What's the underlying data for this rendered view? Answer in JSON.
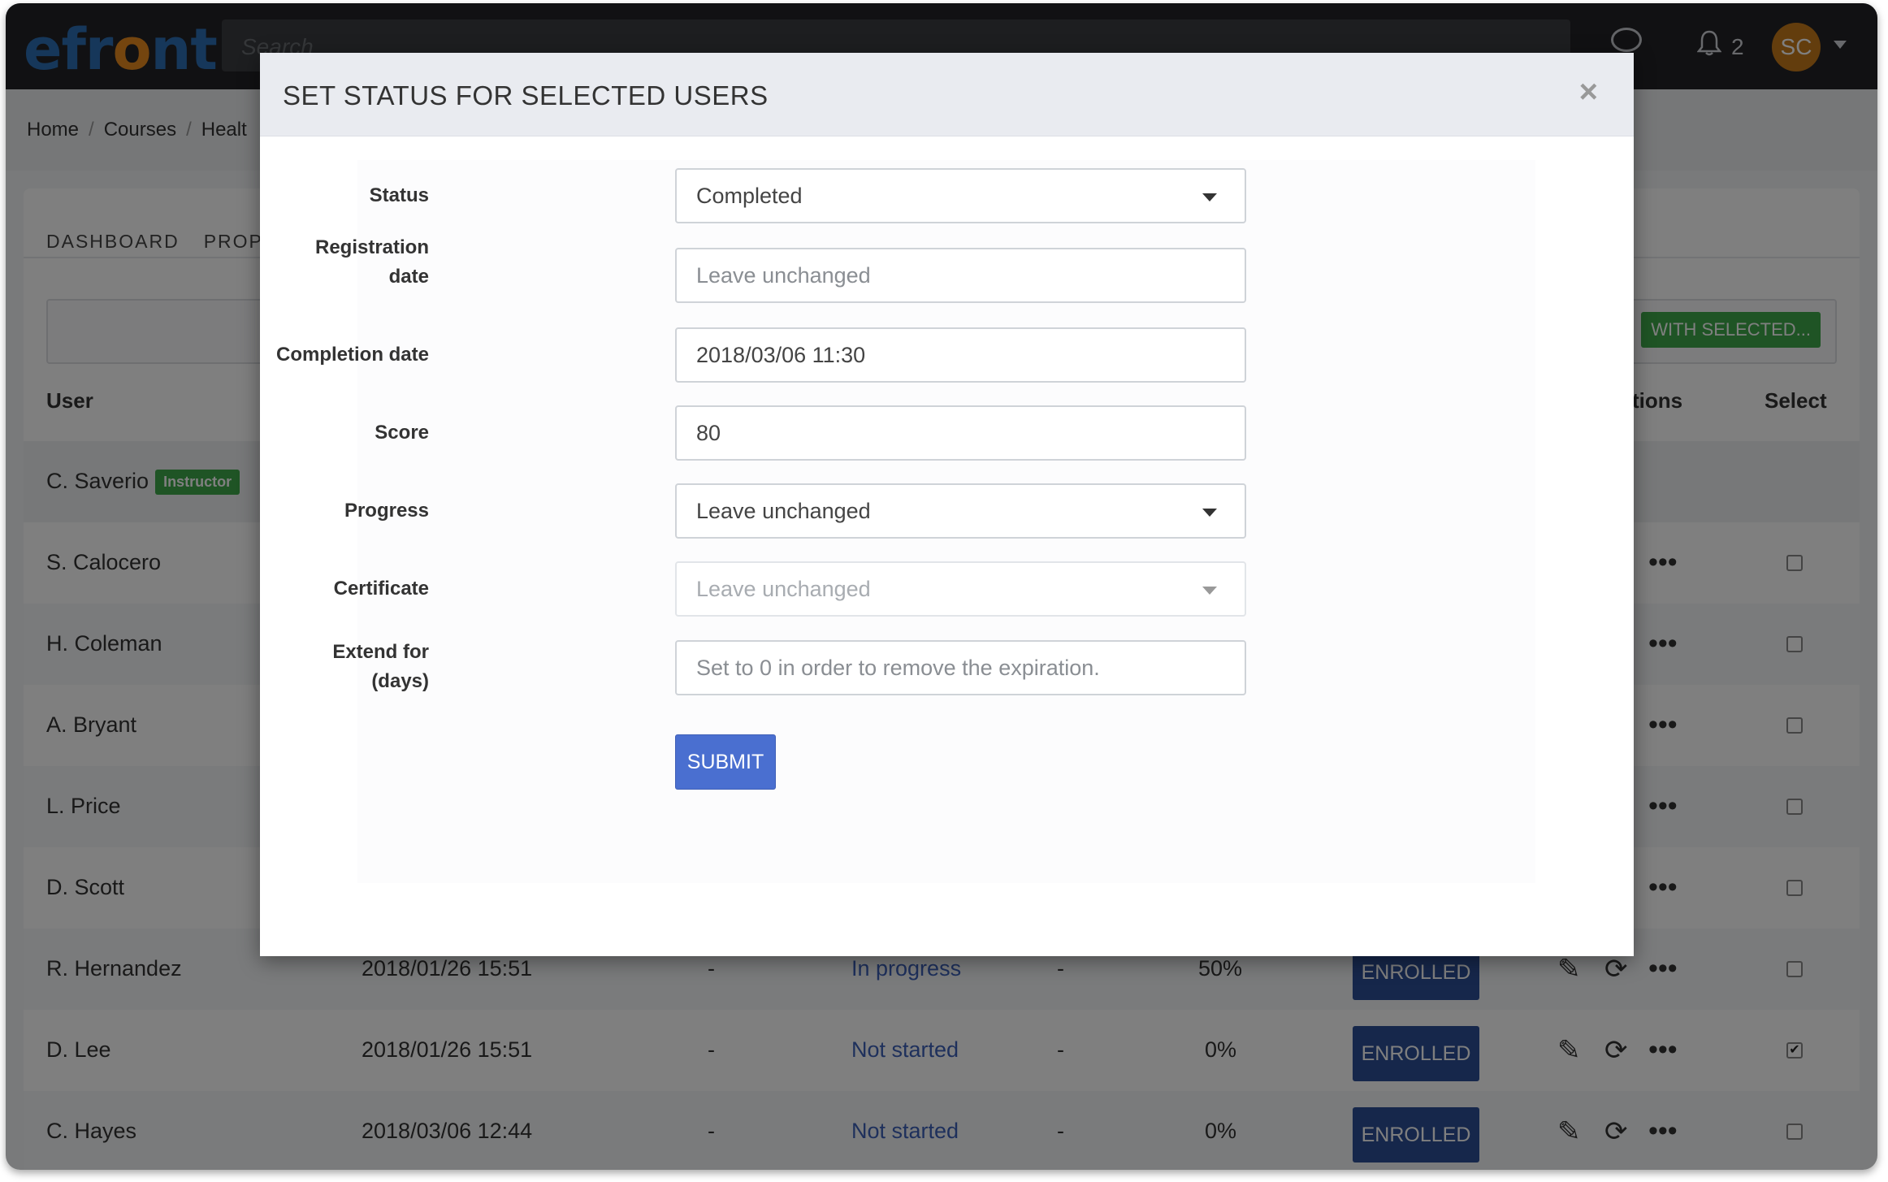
{
  "app": {
    "logo_prefix": "efr",
    "logo_o": "o",
    "logo_suffix": "nt",
    "search_placeholder": "Search",
    "notification_count": "2",
    "avatar_initials": "SC"
  },
  "breadcrumb": [
    "Home",
    "Courses",
    "Healt"
  ],
  "tabs": [
    "DASHBOARD",
    "PROPE"
  ],
  "toolbar": {
    "with_selected_label": "WITH SELECTED..."
  },
  "table": {
    "headers": {
      "user": "User",
      "actions": "tions",
      "select": "Select"
    },
    "rows": [
      {
        "user": "C. Saverio",
        "badge": "Instructor"
      },
      {
        "user": "S. Calocero"
      },
      {
        "user": "H. Coleman"
      },
      {
        "user": "A. Bryant"
      },
      {
        "user": "L. Price"
      },
      {
        "user": "D. Scott"
      },
      {
        "user": "R. Hernandez",
        "registered": "2018/01/26 15:51",
        "dash1": "-",
        "status": "In progress",
        "dash2": "-",
        "progress": "50%",
        "enrollment": "ENROLLED",
        "checked": false
      },
      {
        "user": "D. Lee",
        "registered": "2018/01/26 15:51",
        "dash1": "-",
        "status": "Not started",
        "dash2": "-",
        "progress": "0%",
        "enrollment": "ENROLLED",
        "checked": true
      },
      {
        "user": "C. Hayes",
        "registered": "2018/03/06 12:44",
        "dash1": "-",
        "status": "Not started",
        "dash2": "-",
        "progress": "0%",
        "enrollment": "ENROLLED",
        "checked": false
      }
    ]
  },
  "modal": {
    "title": "SET STATUS FOR SELECTED USERS",
    "close": "×",
    "fields": {
      "status": {
        "label": "Status",
        "value": "Completed"
      },
      "registration_date": {
        "label_line1": "Registration",
        "label_line2": "date",
        "placeholder": "Leave unchanged"
      },
      "completion_date": {
        "label": "Completion date",
        "value": "2018/03/06 11:30"
      },
      "score": {
        "label": "Score",
        "value": "80"
      },
      "progress": {
        "label": "Progress",
        "value": "Leave unchanged"
      },
      "certificate": {
        "label": "Certificate",
        "value": "Leave unchanged"
      },
      "extend": {
        "label_line1": "Extend for",
        "label_line2": "(days)",
        "placeholder": "Set to 0 in order to remove the expiration."
      }
    },
    "submit_label": "SUBMIT"
  },
  "icons": {
    "chat": "chat-icon",
    "bell": "bell-icon",
    "edit": "pencil-icon",
    "reset": "refresh-icon",
    "more": "more-icon"
  }
}
